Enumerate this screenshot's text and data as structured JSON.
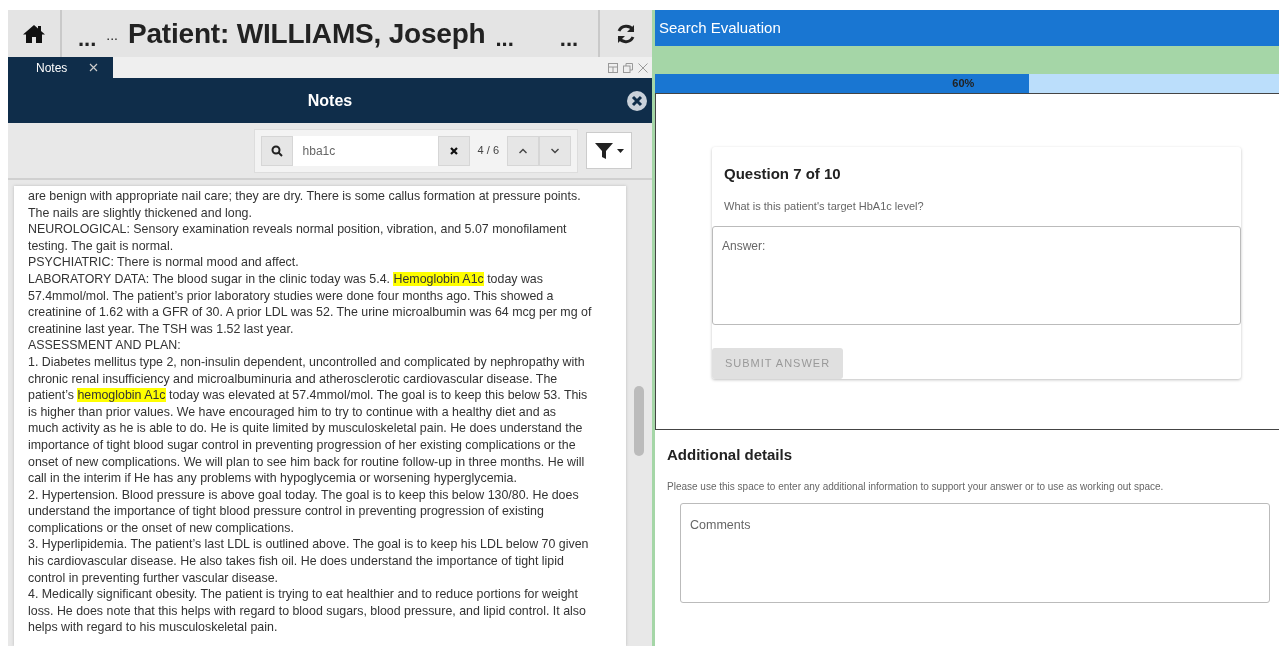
{
  "header": {
    "left_marks": [
      "...",
      "..."
    ],
    "title": "Patient: WILLIAMS, Joseph",
    "right_marks": [
      "...",
      "..."
    ]
  },
  "tabs": [
    {
      "label": "Notes",
      "selected": true
    }
  ],
  "notes_panel": {
    "title": "Notes"
  },
  "search": {
    "value": "hba1c",
    "match_count": "4 / 6"
  },
  "note_lines": [
    [
      {
        "text": "are benign with appropriate nail care; they are dry. There is some callus formation at pressure points.",
        "highlighted": false
      }
    ],
    [
      {
        "text": "The nails are slightly thickened and long.",
        "highlighted": false
      }
    ],
    [
      {
        "text": "NEUROLOGICAL: Sensory examination reveals normal position, vibration, and 5.07 monofilament",
        "highlighted": false
      }
    ],
    [
      {
        "text": "testing. The gait is normal.",
        "highlighted": false
      }
    ],
    [
      {
        "text": "PSYCHIATRIC: There is normal mood and affect.",
        "highlighted": false
      }
    ],
    [
      {
        "text": "LABORATORY DATA: The blood sugar in the clinic today was 5.4. ",
        "highlighted": false
      },
      {
        "text": "Hemoglobin A1c",
        "highlighted": true
      },
      {
        "text": " today was",
        "highlighted": false
      }
    ],
    [
      {
        "text": "57.4mmol/mol. The patient’s prior laboratory studies were done four months ago. This showed a",
        "highlighted": false
      }
    ],
    [
      {
        "text": "creatinine of 1.62 with a GFR of 30. A prior LDL was 52. The urine microalbumin was 64 mcg per mg of",
        "highlighted": false
      }
    ],
    [
      {
        "text": "creatinine last year. The TSH was 1.52 last year.",
        "highlighted": false
      }
    ],
    [
      {
        "text": "ASSESSMENT AND PLAN:",
        "highlighted": false
      }
    ],
    [
      {
        "text": "1. Diabetes mellitus type 2, non-insulin dependent, uncontrolled and complicated by nephropathy with",
        "highlighted": false
      }
    ],
    [
      {
        "text": "chronic renal insufficiency and microalbuminuria and atherosclerotic cardiovascular disease. The",
        "highlighted": false
      }
    ],
    [
      {
        "text": "patient’s ",
        "highlighted": false
      },
      {
        "text": "hemoglobin A1c",
        "highlighted": true
      },
      {
        "text": " today was elevated at 57.4mmol/mol. The goal is to keep this below 53. This",
        "highlighted": false
      }
    ],
    [
      {
        "text": "is higher than prior values. We have encouraged him to try to continue with a healthy diet and as",
        "highlighted": false
      }
    ],
    [
      {
        "text": "much activity as he is able to do. He is quite limited by musculoskeletal pain. He does understand the",
        "highlighted": false
      }
    ],
    [
      {
        "text": "importance of tight blood sugar control in preventing progression of her existing complications or the",
        "highlighted": false
      }
    ],
    [
      {
        "text": "onset of new complications. We will plan to see him back for routine follow-up in three months. He will",
        "highlighted": false
      }
    ],
    [
      {
        "text": "call in the interim if He has any problems with hypoglycemia or worsening hyperglycemia.",
        "highlighted": false
      }
    ],
    [
      {
        "text": "2. Hypertension. Blood pressure is above goal today. The goal is to keep this below 130/80. He does",
        "highlighted": false
      }
    ],
    [
      {
        "text": "understand the importance of tight blood pressure control in preventing progression of existing",
        "highlighted": false
      }
    ],
    [
      {
        "text": "complications or the onset of new complications.",
        "highlighted": false
      }
    ],
    [
      {
        "text": "3. Hyperlipidemia. The patient’s last LDL is outlined above. The goal is to keep his LDL below 70 given",
        "highlighted": false
      }
    ],
    [
      {
        "text": "his cardiovascular disease. He also takes fish oil. He does understand the importance of tight lipid",
        "highlighted": false
      }
    ],
    [
      {
        "text": "control in preventing further vascular disease.",
        "highlighted": false
      }
    ],
    [
      {
        "text": "4. Medically significant obesity. The patient is trying to eat healthier and to reduce portions for weight",
        "highlighted": false
      }
    ],
    [
      {
        "text": "loss. He does note that this helps with regard to blood sugars, blood pressure, and lipid control. It also",
        "highlighted": false
      }
    ],
    [
      {
        "text": "helps with regard to his musculoskeletal pain.",
        "highlighted": false
      }
    ]
  ],
  "evaluation": {
    "title": "Search Evaluation",
    "progress": {
      "level": 0.6,
      "label": "60%"
    },
    "question": {
      "heading": "Question 7 of 10",
      "text": "What is this patient's target HbA1c level?",
      "answer_placeholder": "Answer:",
      "submit": {
        "label": "SUBMIT ANSWER",
        "disabled": true
      }
    },
    "additional": {
      "heading": "Additional details",
      "text": "Please use this space to enter any additional information to support your answer or to use as working out space.",
      "placeholder": "Comments"
    }
  }
}
